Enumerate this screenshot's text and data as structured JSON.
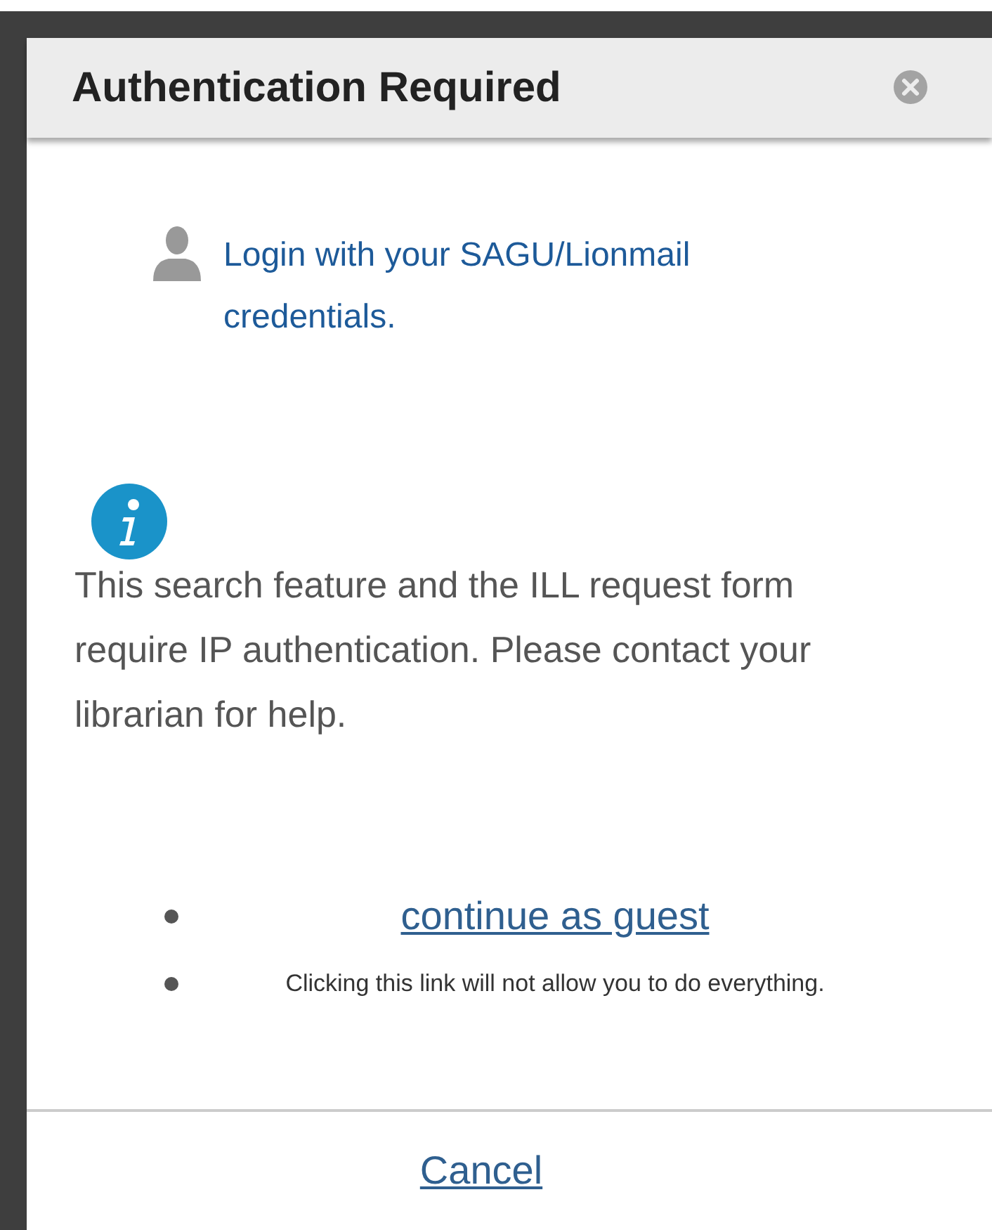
{
  "dialog": {
    "title": "Authentication Required"
  },
  "login": {
    "text": "Login with your SAGU/Lionmail credentials."
  },
  "info": {
    "text": "This search feature and the ILL request form require IP authentication. Please contact your librarian for help."
  },
  "options": [
    {
      "kind": "link",
      "text": "continue as guest"
    },
    {
      "kind": "note",
      "text": "Clicking this link will not allow you to do everything."
    }
  ],
  "footer": {
    "cancel": "Cancel"
  }
}
